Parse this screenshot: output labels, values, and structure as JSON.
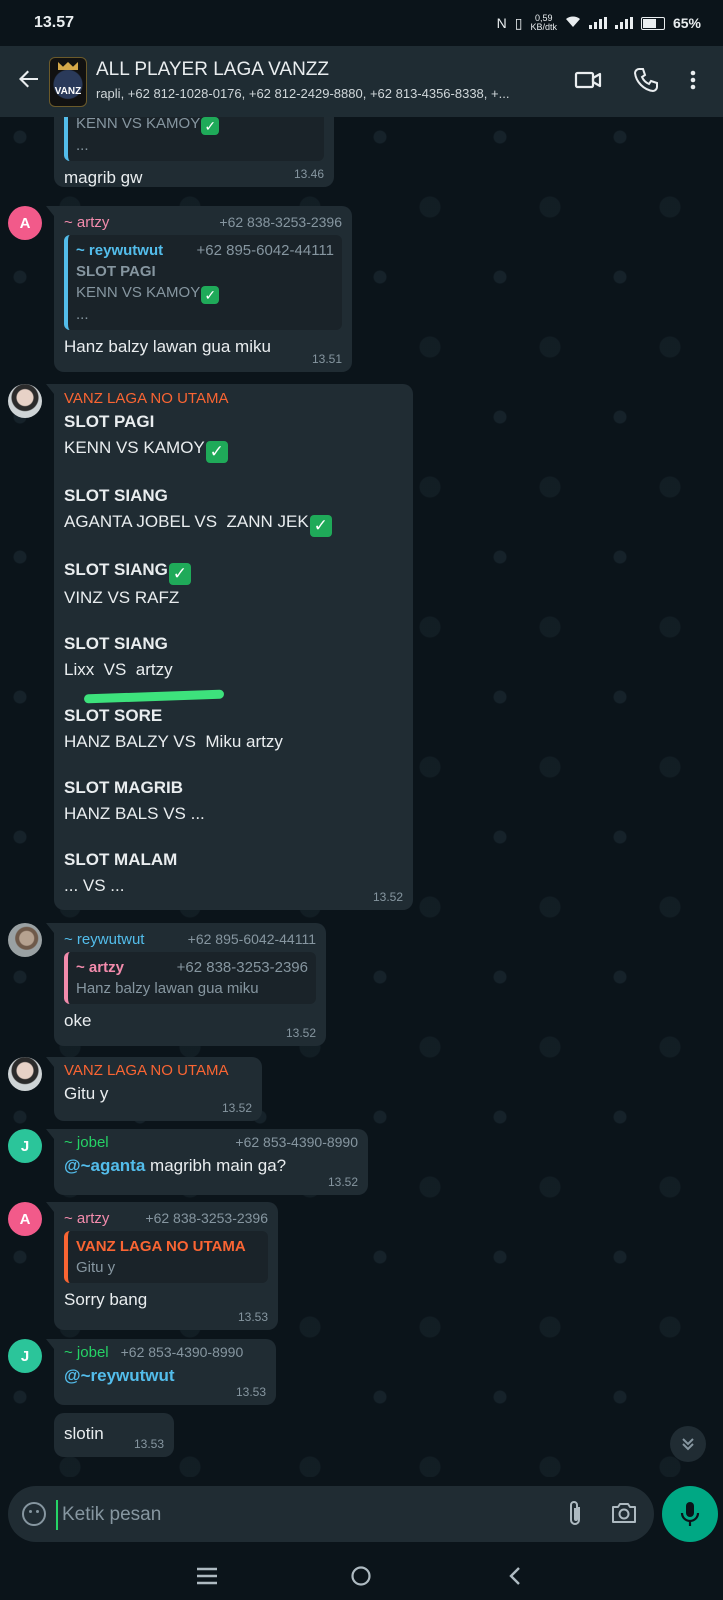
{
  "status": {
    "time": "13.57",
    "net_top": "0,59",
    "net_bottom": "KB/dtk",
    "battery": "65%"
  },
  "header": {
    "title": "ALL PLAYER LAGA VANZZ",
    "subtitle": "rapli, +62 812-1028-0176, +62 812-2429-8880, +62 813-4356-8338, +...",
    "avatar_text": "VANZ"
  },
  "messages": {
    "m1": {
      "quote_line": "KENN VS KAMOY",
      "quote_more": "...",
      "text": "magrib gw",
      "time": "13.46"
    },
    "m2": {
      "avatar": "A",
      "sender": "~ artzy",
      "phone": "+62 838-3253-2396",
      "quote_sender": "~ reywutwut",
      "quote_phone": "+62 895-6042-44111",
      "quote_line1": "SLOT PAGI",
      "quote_line2": "KENN VS KAMOY",
      "quote_more": "...",
      "text": "Hanz balzy lawan gua miku",
      "time": "13.51"
    },
    "m3": {
      "sender": "VANZ LAGA NO UTAMA",
      "slots": [
        {
          "title": "SLOT PAGI",
          "match": "KENN VS KAMOY"
        },
        {
          "title": "SLOT SIANG",
          "match": "AGANTA JOBEL VS  ZANN JEK"
        },
        {
          "title": "SLOT SIANG",
          "match": "VINZ VS RAFZ"
        },
        {
          "title": "SLOT SIANG",
          "match": "Lixx  VS  artzy"
        },
        {
          "title": "SLOT SORE",
          "match": "HANZ BALZY VS  Miku artzy"
        },
        {
          "title": "SLOT MAGRIB",
          "match": "HANZ BALS VS ..."
        },
        {
          "title": "SLOT MALAM",
          "match": "... VS ..."
        }
      ],
      "time": "13.52"
    },
    "m4": {
      "sender": "~ reywutwut",
      "phone": "+62 895-6042-44111",
      "quote_sender": "~ artzy",
      "quote_phone": "+62 838-3253-2396",
      "quote_text": "Hanz balzy lawan gua miku",
      "text": "oke",
      "time": "13.52"
    },
    "m5": {
      "sender": "VANZ LAGA NO UTAMA",
      "text": "Gitu y",
      "time": "13.52"
    },
    "m6": {
      "avatar": "J",
      "sender": "~ jobel",
      "phone": "+62 853-4390-8990",
      "mention": "@~aganta",
      "text": " magribh main ga?",
      "time": "13.52"
    },
    "m7": {
      "avatar": "A",
      "sender": "~ artzy",
      "phone": "+62 838-3253-2396",
      "quote_sender": "VANZ LAGA NO UTAMA",
      "quote_text": "Gitu y",
      "text": "Sorry bang",
      "time": "13.53"
    },
    "m8": {
      "avatar": "J",
      "sender": "~ jobel",
      "phone": "+62 853-4390-8990",
      "mention": "@~reywutwut",
      "time": "13.53"
    },
    "m9": {
      "text": "slotin",
      "time": "13.53"
    }
  },
  "input": {
    "placeholder": "Ketik pesan"
  },
  "colors": {
    "bg": "#0b141a",
    "bubble": "#202c33",
    "header": "#1f2c33",
    "accent": "#00a884",
    "check": "#1faa59"
  },
  "icons": [
    "back-arrow-icon",
    "video-call-icon",
    "phone-icon",
    "more-vert-icon",
    "emoji-icon",
    "attach-icon",
    "camera-icon",
    "mic-icon",
    "scroll-down-icon",
    "nav-recents-icon",
    "nav-home-icon",
    "nav-back-icon",
    "check-mark-icon"
  ]
}
